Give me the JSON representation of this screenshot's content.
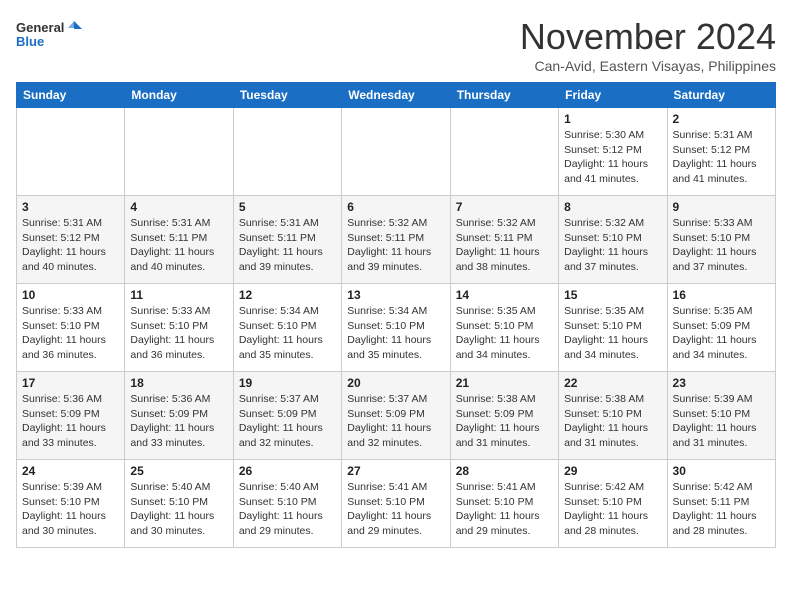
{
  "header": {
    "logo_line1": "General",
    "logo_line2": "Blue",
    "month_title": "November 2024",
    "location": "Can-Avid, Eastern Visayas, Philippines"
  },
  "days_of_week": [
    "Sunday",
    "Monday",
    "Tuesday",
    "Wednesday",
    "Thursday",
    "Friday",
    "Saturday"
  ],
  "weeks": [
    [
      {
        "day": "",
        "info": ""
      },
      {
        "day": "",
        "info": ""
      },
      {
        "day": "",
        "info": ""
      },
      {
        "day": "",
        "info": ""
      },
      {
        "day": "",
        "info": ""
      },
      {
        "day": "1",
        "info": "Sunrise: 5:30 AM\nSunset: 5:12 PM\nDaylight: 11 hours\nand 41 minutes."
      },
      {
        "day": "2",
        "info": "Sunrise: 5:31 AM\nSunset: 5:12 PM\nDaylight: 11 hours\nand 41 minutes."
      }
    ],
    [
      {
        "day": "3",
        "info": "Sunrise: 5:31 AM\nSunset: 5:12 PM\nDaylight: 11 hours\nand 40 minutes."
      },
      {
        "day": "4",
        "info": "Sunrise: 5:31 AM\nSunset: 5:11 PM\nDaylight: 11 hours\nand 40 minutes."
      },
      {
        "day": "5",
        "info": "Sunrise: 5:31 AM\nSunset: 5:11 PM\nDaylight: 11 hours\nand 39 minutes."
      },
      {
        "day": "6",
        "info": "Sunrise: 5:32 AM\nSunset: 5:11 PM\nDaylight: 11 hours\nand 39 minutes."
      },
      {
        "day": "7",
        "info": "Sunrise: 5:32 AM\nSunset: 5:11 PM\nDaylight: 11 hours\nand 38 minutes."
      },
      {
        "day": "8",
        "info": "Sunrise: 5:32 AM\nSunset: 5:10 PM\nDaylight: 11 hours\nand 37 minutes."
      },
      {
        "day": "9",
        "info": "Sunrise: 5:33 AM\nSunset: 5:10 PM\nDaylight: 11 hours\nand 37 minutes."
      }
    ],
    [
      {
        "day": "10",
        "info": "Sunrise: 5:33 AM\nSunset: 5:10 PM\nDaylight: 11 hours\nand 36 minutes."
      },
      {
        "day": "11",
        "info": "Sunrise: 5:33 AM\nSunset: 5:10 PM\nDaylight: 11 hours\nand 36 minutes."
      },
      {
        "day": "12",
        "info": "Sunrise: 5:34 AM\nSunset: 5:10 PM\nDaylight: 11 hours\nand 35 minutes."
      },
      {
        "day": "13",
        "info": "Sunrise: 5:34 AM\nSunset: 5:10 PM\nDaylight: 11 hours\nand 35 minutes."
      },
      {
        "day": "14",
        "info": "Sunrise: 5:35 AM\nSunset: 5:10 PM\nDaylight: 11 hours\nand 34 minutes."
      },
      {
        "day": "15",
        "info": "Sunrise: 5:35 AM\nSunset: 5:10 PM\nDaylight: 11 hours\nand 34 minutes."
      },
      {
        "day": "16",
        "info": "Sunrise: 5:35 AM\nSunset: 5:09 PM\nDaylight: 11 hours\nand 34 minutes."
      }
    ],
    [
      {
        "day": "17",
        "info": "Sunrise: 5:36 AM\nSunset: 5:09 PM\nDaylight: 11 hours\nand 33 minutes."
      },
      {
        "day": "18",
        "info": "Sunrise: 5:36 AM\nSunset: 5:09 PM\nDaylight: 11 hours\nand 33 minutes."
      },
      {
        "day": "19",
        "info": "Sunrise: 5:37 AM\nSunset: 5:09 PM\nDaylight: 11 hours\nand 32 minutes."
      },
      {
        "day": "20",
        "info": "Sunrise: 5:37 AM\nSunset: 5:09 PM\nDaylight: 11 hours\nand 32 minutes."
      },
      {
        "day": "21",
        "info": "Sunrise: 5:38 AM\nSunset: 5:09 PM\nDaylight: 11 hours\nand 31 minutes."
      },
      {
        "day": "22",
        "info": "Sunrise: 5:38 AM\nSunset: 5:10 PM\nDaylight: 11 hours\nand 31 minutes."
      },
      {
        "day": "23",
        "info": "Sunrise: 5:39 AM\nSunset: 5:10 PM\nDaylight: 11 hours\nand 31 minutes."
      }
    ],
    [
      {
        "day": "24",
        "info": "Sunrise: 5:39 AM\nSunset: 5:10 PM\nDaylight: 11 hours\nand 30 minutes."
      },
      {
        "day": "25",
        "info": "Sunrise: 5:40 AM\nSunset: 5:10 PM\nDaylight: 11 hours\nand 30 minutes."
      },
      {
        "day": "26",
        "info": "Sunrise: 5:40 AM\nSunset: 5:10 PM\nDaylight: 11 hours\nand 29 minutes."
      },
      {
        "day": "27",
        "info": "Sunrise: 5:41 AM\nSunset: 5:10 PM\nDaylight: 11 hours\nand 29 minutes."
      },
      {
        "day": "28",
        "info": "Sunrise: 5:41 AM\nSunset: 5:10 PM\nDaylight: 11 hours\nand 29 minutes."
      },
      {
        "day": "29",
        "info": "Sunrise: 5:42 AM\nSunset: 5:10 PM\nDaylight: 11 hours\nand 28 minutes."
      },
      {
        "day": "30",
        "info": "Sunrise: 5:42 AM\nSunset: 5:11 PM\nDaylight: 11 hours\nand 28 minutes."
      }
    ]
  ]
}
